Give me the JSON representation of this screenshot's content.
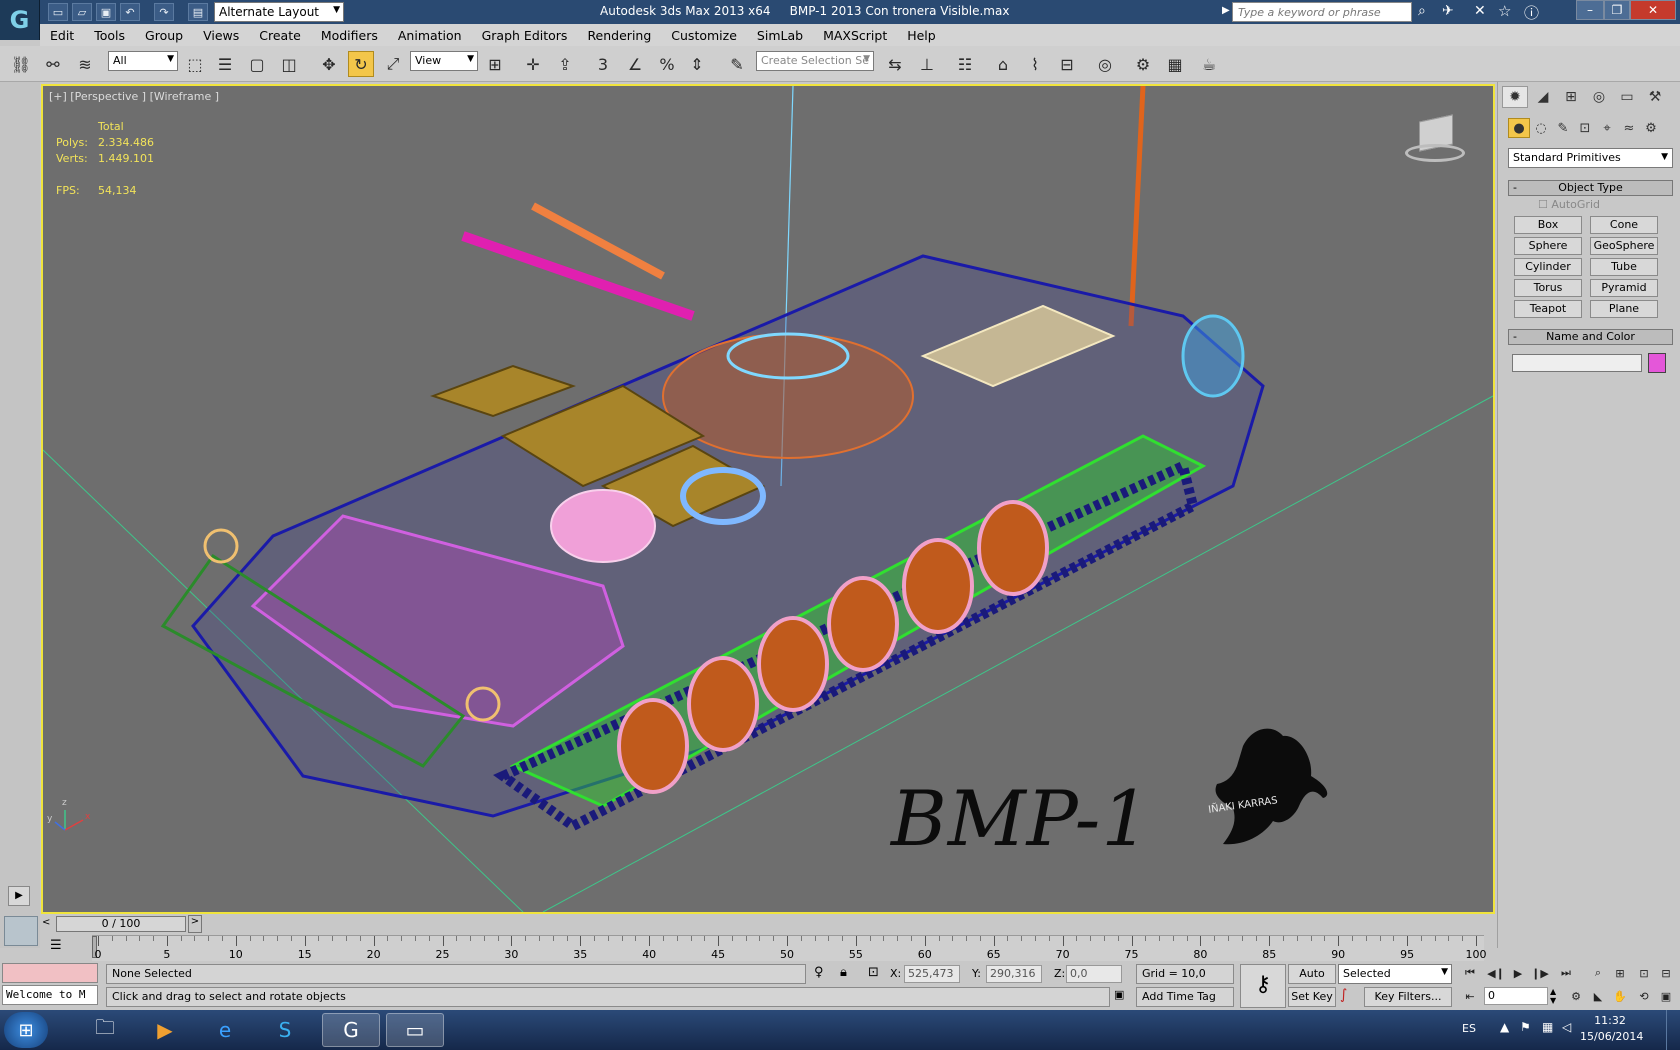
{
  "titlebar": {
    "workspace": "Alternate Layout",
    "app_title": "Autodesk 3ds Max  2013 x64",
    "file_name": "BMP-1 2013 Con tronera Visible.max",
    "search_placeholder": "Type a keyword or phrase"
  },
  "menu": [
    "Edit",
    "Tools",
    "Group",
    "Views",
    "Create",
    "Modifiers",
    "Animation",
    "Graph Editors",
    "Rendering",
    "Customize",
    "SimLab",
    "MAXScript",
    "Help"
  ],
  "toolbar": {
    "filter_value": "All",
    "ref_coord_value": "View",
    "selection_set_placeholder": "Create Selection Se"
  },
  "viewport": {
    "label": "[+] [Perspective ] [Wireframe ]",
    "stats_header": "Total",
    "polys_label": "Polys:",
    "polys_value": "2.334.486",
    "verts_label": "Verts:",
    "verts_value": "1.449.101",
    "fps_label": "FPS:",
    "fps_value": "54,134",
    "watermark_text": "BMP-1",
    "signature": "IÑAKI KARRAS",
    "axis_x": "x",
    "axis_y": "y",
    "axis_z": "z"
  },
  "command_panel": {
    "category": "Standard Primitives",
    "object_type_title": "Object Type",
    "autogrid_label": "AutoGrid",
    "primitives": [
      "Box",
      "Cone",
      "Sphere",
      "GeoSphere",
      "Cylinder",
      "Tube",
      "Torus",
      "Pyramid",
      "Teapot",
      "Plane"
    ],
    "name_color_title": "Name and Color",
    "object_color": "#e457d9"
  },
  "timeline": {
    "frame_display": "0 / 100",
    "ticks": [
      "0",
      "5",
      "10",
      "15",
      "20",
      "25",
      "30",
      "35",
      "40",
      "45",
      "50",
      "55",
      "60",
      "65",
      "70",
      "75",
      "80",
      "85",
      "90",
      "95",
      "100"
    ]
  },
  "status": {
    "maxscript_listener": "Welcome to M",
    "selection": "None Selected",
    "prompt": "Click and drag to select and rotate objects",
    "x_label": "X:",
    "x_value": "525,473",
    "y_label": "Y:",
    "y_value": "290,316",
    "z_label": "Z:",
    "z_value": "0,0",
    "grid": "Grid = 10,0",
    "add_time_tag": "Add Time Tag",
    "auto_key": "Auto Key",
    "set_key": "Set Key",
    "key_mode": "Selected",
    "key_filters": "Key Filters...",
    "current_frame": "0"
  },
  "taskbar": {
    "language": "ES",
    "time": "11:32",
    "date": "15/06/2014"
  },
  "colors": {
    "titlebar": "#2a4a72",
    "viewport_bg": "#6e6e6e",
    "viewport_border": "#f0e43c",
    "stats_text": "#f2e35a",
    "active_tool": "#f3c64a"
  }
}
